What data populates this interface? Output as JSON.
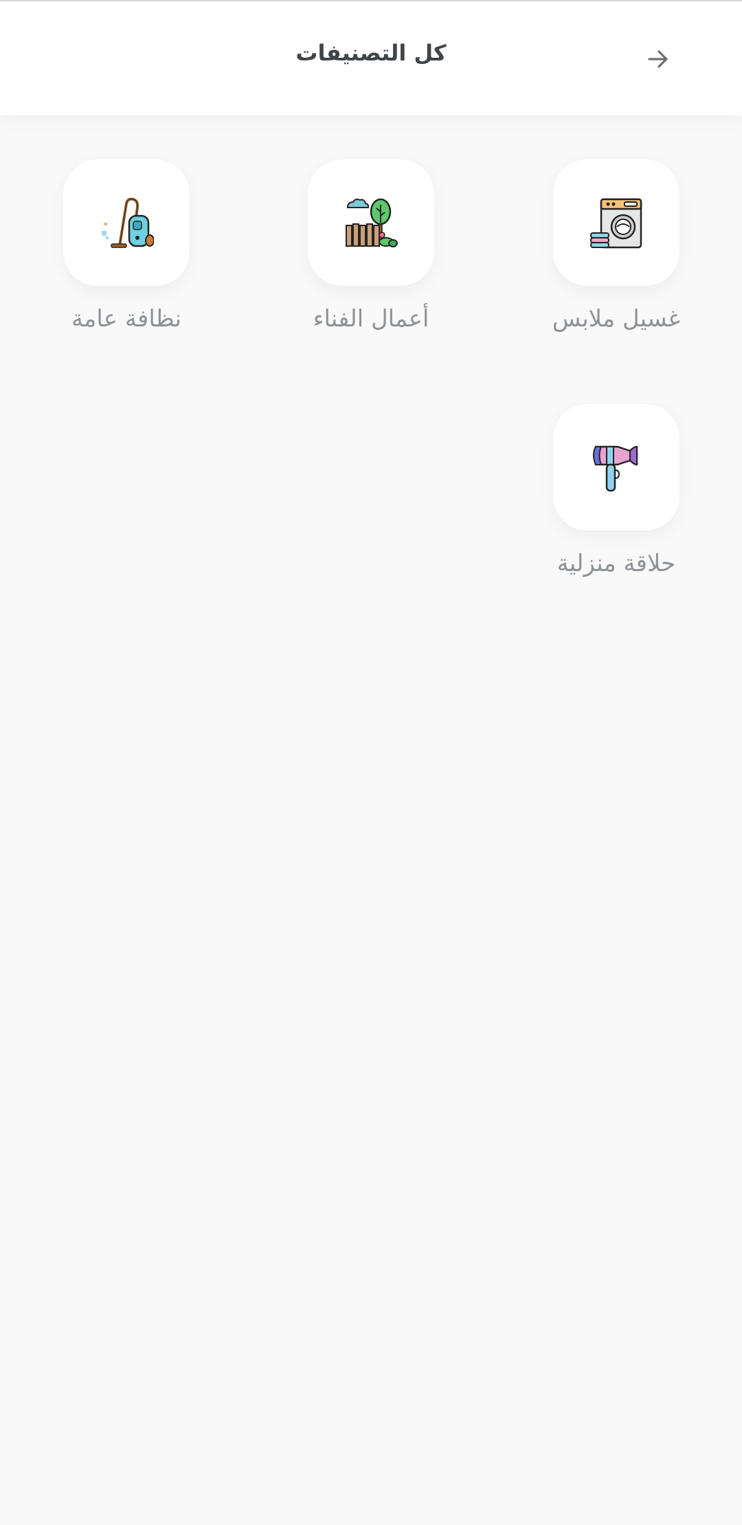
{
  "header": {
    "title": "كل التصنيفات",
    "back_icon": "arrow-right-icon"
  },
  "categories": [
    {
      "label": "غسيل ملابس",
      "icon": "washing-machine-icon"
    },
    {
      "label": "أعمال الفناء",
      "icon": "garden-fence-icon"
    },
    {
      "label": "نظافة عامة",
      "icon": "vacuum-cleaner-icon"
    },
    {
      "label": "حلاقة منزلية",
      "icon": "hair-dryer-icon"
    }
  ],
  "colors": {
    "background": "#f9f9f9",
    "header_bg": "#ffffff",
    "title_text": "#3f4549",
    "label_text": "#8e9296"
  }
}
